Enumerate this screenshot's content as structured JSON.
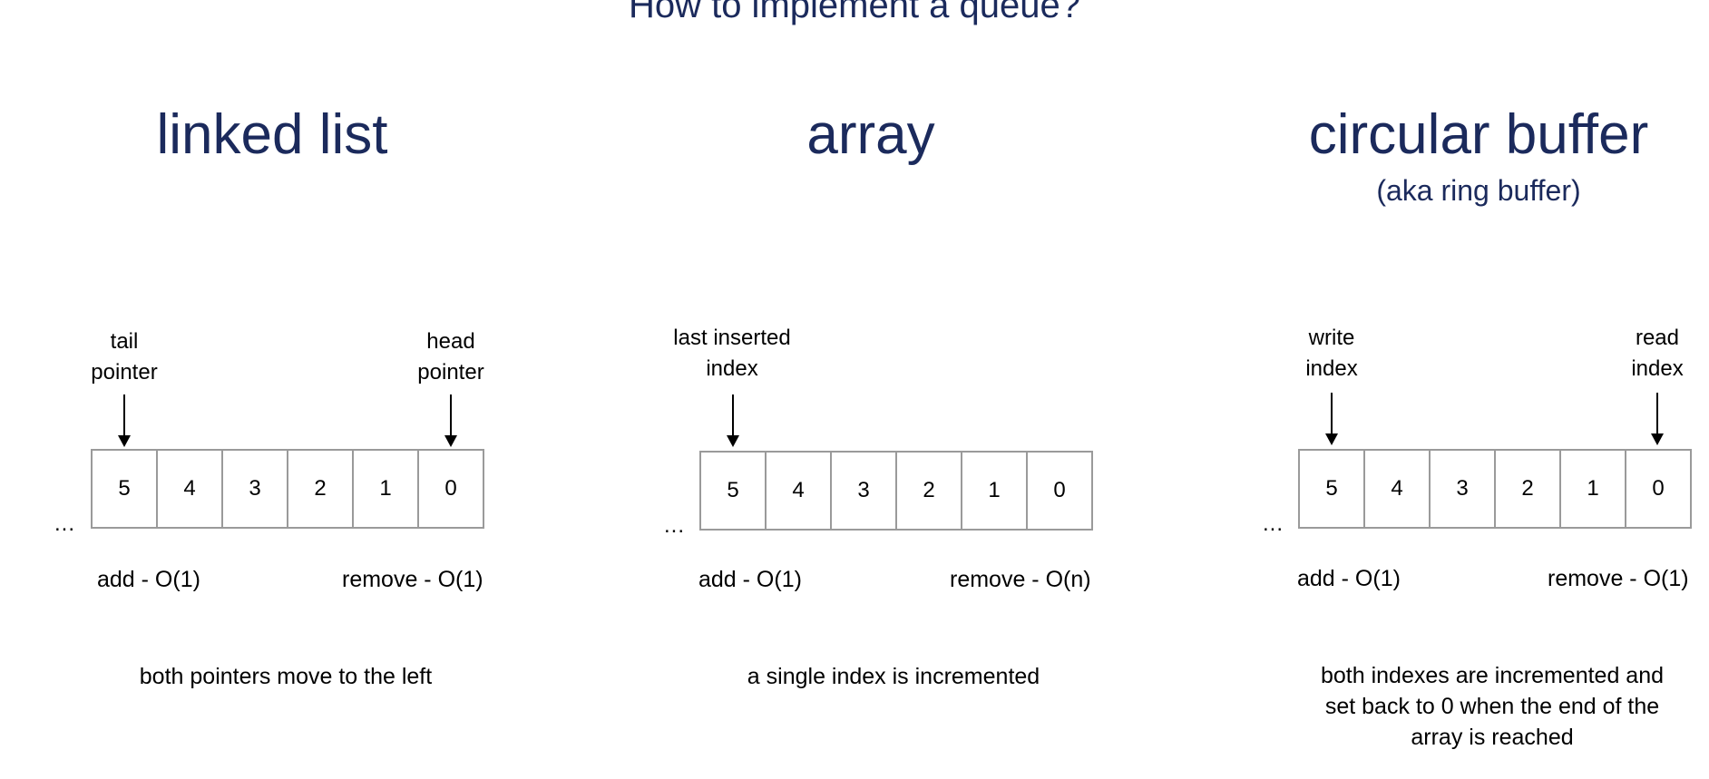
{
  "title": "How to implement a queue?",
  "sections": [
    {
      "title": "linked list",
      "subtitle": "",
      "left_pointer": [
        "tail",
        "pointer"
      ],
      "right_pointer": [
        "head",
        "pointer"
      ],
      "cells": [
        "5",
        "4",
        "3",
        "2",
        "1",
        "0"
      ],
      "ellipsis": "...",
      "add_op": "add - O(1)",
      "remove_op": "remove - O(1)",
      "description": [
        "both pointers move to the left"
      ]
    },
    {
      "title": "array",
      "subtitle": "",
      "left_pointer": [
        "last inserted",
        "index"
      ],
      "right_pointer": [],
      "cells": [
        "5",
        "4",
        "3",
        "2",
        "1",
        "0"
      ],
      "ellipsis": "...",
      "add_op": "add - O(1)",
      "remove_op": "remove - O(n)",
      "description": [
        "a single index is incremented"
      ]
    },
    {
      "title": "circular buffer",
      "subtitle": "(aka ring buffer)",
      "left_pointer": [
        "write",
        "index"
      ],
      "right_pointer": [
        "read",
        "index"
      ],
      "cells": [
        "5",
        "4",
        "3",
        "2",
        "1",
        "0"
      ],
      "ellipsis": "...",
      "add_op": "add - O(1)",
      "remove_op": "remove - O(1)",
      "description": [
        "both indexes are incremented and",
        "set back to 0 when the end of the",
        "array is reached"
      ]
    }
  ]
}
